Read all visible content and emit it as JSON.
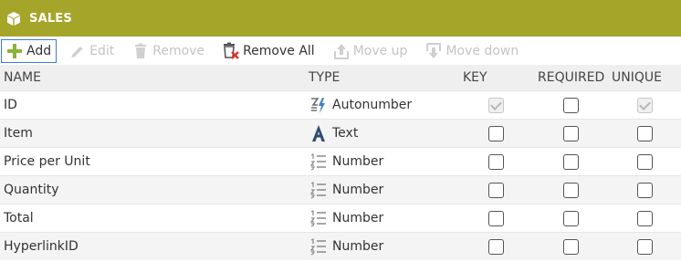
{
  "window": {
    "title": "SALES",
    "icon": "cube-icon",
    "accent": "#a5a52a"
  },
  "toolbar": {
    "add": {
      "label": "Add",
      "icon": "plus-icon",
      "enabled": true
    },
    "edit": {
      "label": "Edit",
      "icon": "pencil-icon",
      "enabled": false
    },
    "remove": {
      "label": "Remove",
      "icon": "trash-icon",
      "enabled": false
    },
    "remove_all": {
      "label": "Remove All",
      "icon": "trash-x-icon",
      "enabled": true
    },
    "move_up": {
      "label": "Move up",
      "icon": "move-up-icon",
      "enabled": false
    },
    "move_down": {
      "label": "Move down",
      "icon": "move-down-icon",
      "enabled": false
    }
  },
  "columns": {
    "name": "NAME",
    "type": "TYPE",
    "key": "KEY",
    "required": "REQUIRED",
    "unique": "UNIQUE"
  },
  "rows": [
    {
      "name": "ID",
      "type": "Autonumber",
      "type_icon": "autonumber-icon",
      "key": true,
      "key_disabled": true,
      "required": false,
      "unique": true,
      "unique_disabled": true
    },
    {
      "name": "Item",
      "type": "Text",
      "type_icon": "text-type-icon",
      "key": false,
      "required": false,
      "unique": false
    },
    {
      "name": "Price per Unit",
      "type": "Number",
      "type_icon": "number-type-icon",
      "key": false,
      "required": false,
      "unique": false
    },
    {
      "name": "Quantity",
      "type": "Number",
      "type_icon": "number-type-icon",
      "key": false,
      "required": false,
      "unique": false
    },
    {
      "name": "Total",
      "type": "Number",
      "type_icon": "number-type-icon",
      "key": false,
      "required": false,
      "unique": false
    },
    {
      "name": "HyperlinkID",
      "type": "Number",
      "type_icon": "number-type-icon",
      "key": false,
      "required": false,
      "unique": false
    }
  ]
}
